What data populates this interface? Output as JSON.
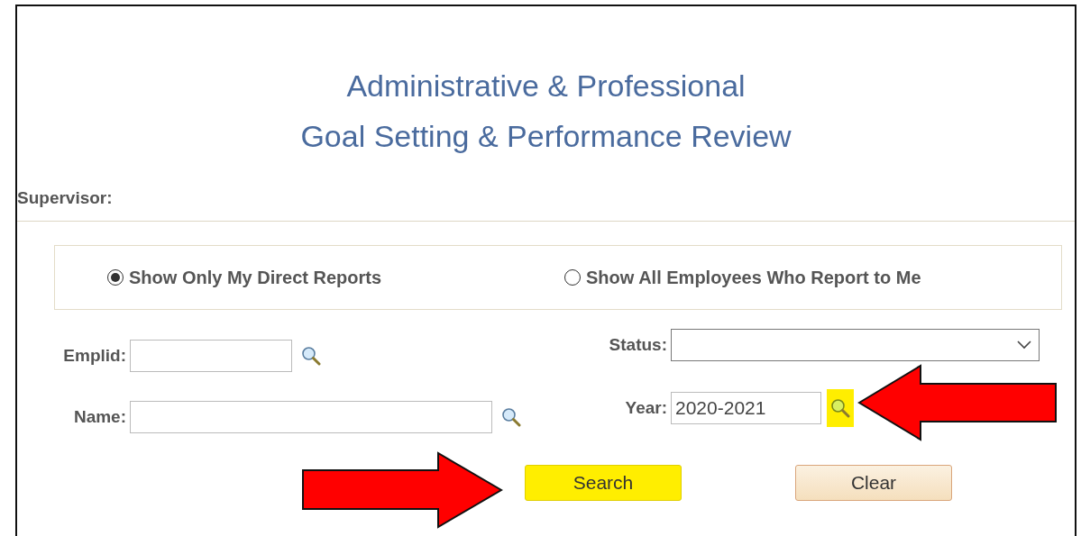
{
  "title_lines": [
    "Administrative & Professional",
    "Goal Setting & Performance Review"
  ],
  "supervisor_label": "Supervisor:",
  "report_scope": [
    {
      "label": "Show Only My Direct Reports",
      "selected": true
    },
    {
      "label": "Show All Employees Who Report to Me",
      "selected": false
    }
  ],
  "left_fields": [
    {
      "label": "Emplid:",
      "kind": "lookup",
      "highlighted": false
    },
    {
      "label": "Name:",
      "kind": "lookup",
      "highlighted": false
    }
  ],
  "right_fields": [
    {
      "label": "Status:",
      "kind": "select"
    },
    {
      "label": "Year:",
      "kind": "lookup",
      "value": "2020-2021",
      "highlighted": true
    }
  ],
  "buttons": [
    {
      "label": "Search",
      "highlighted": true
    },
    {
      "label": "Clear",
      "highlighted": false
    }
  ],
  "annotation_arrows": [
    {
      "kind": "rightward"
    },
    {
      "kind": "leftward"
    }
  ]
}
